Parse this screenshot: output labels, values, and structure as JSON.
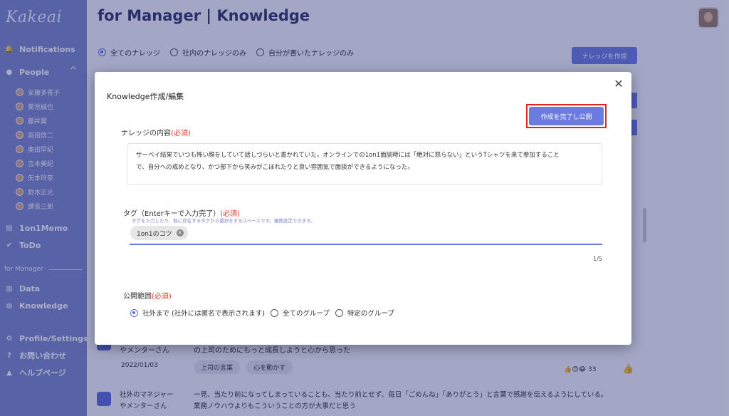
{
  "sidebar": {
    "logo": "Kakeai",
    "notifications": "Notifications",
    "people": "People",
    "people_list": [
      "安藤多香子",
      "菊池誠也",
      "藤井翼",
      "高田信二",
      "奥田早紀",
      "吉本美紀",
      "矢本玲奈",
      "鈴木正光",
      "課長三郎"
    ],
    "memo": "1on1Memo",
    "todo": "ToDo",
    "section_manager": "for Manager",
    "data": "Data",
    "knowledge": "Knowledge",
    "profile": "Profile/Settings",
    "contact": "お問い合わせ",
    "help": "ヘルプページ"
  },
  "header": {
    "title": "for Manager | Knowledge"
  },
  "filters": {
    "all": "全てのナレッジ",
    "company": "社内のナレッジのみ",
    "mine": "自分が書いたナレッジのみ",
    "create_button": "ナレッジを作成"
  },
  "background_rows": {
    "row1_author": "やメンターさん",
    "row1_text": "の上司のためにもっと成長しようと心から思った",
    "row1_date": "2022/01/03",
    "row1_tags": [
      "上司の言葉",
      "心を動かす"
    ],
    "row1_count": "33",
    "row2_author1": "社外のマネジャー",
    "row2_author2": "やメンターさん",
    "row2_text1": "一見、当たり前になってしまっていることも、当たり前とせず、毎日「ごめんね」「ありがとう」と言葉で感謝を伝えるようにしている。",
    "row2_text2": "業務ノウハウよりもこういうことの方が大事だと思う"
  },
  "modal": {
    "title": "Knowledge作成/編集",
    "publish_button": "作成を完了し公開",
    "content_label": "ナレッジの内容",
    "required": "(必須)",
    "content_line1": "サーベイ結果でいつも怖い顔をしていて話しづらいと書かれていた。オンラインでの1on1面談時には「絶対に怒らない」というTシャツを来て参加すること",
    "content_line2": "で、自分への戒めとなり、かつ部下から笑みがこぼれたりと良い雰囲気で面談ができるようになった。",
    "tag_label": "タグ（Enterキーで入力完了）",
    "tag_hint": "タグを入力したり、既に存在するタグから選択をするスペースです。複数設定できます。",
    "tag": "1on1のコツ",
    "tag_counter": "1/5",
    "scope_label": "公開範囲",
    "scope_options": [
      "社外まで (社外には匿名で表示されます)",
      "全てのグループ",
      "特定のグループ"
    ]
  },
  "colors": {
    "sidebar": "#7d86c9",
    "accent": "#6b7be0",
    "required": "#e0342c",
    "highlight": "#e02424"
  }
}
